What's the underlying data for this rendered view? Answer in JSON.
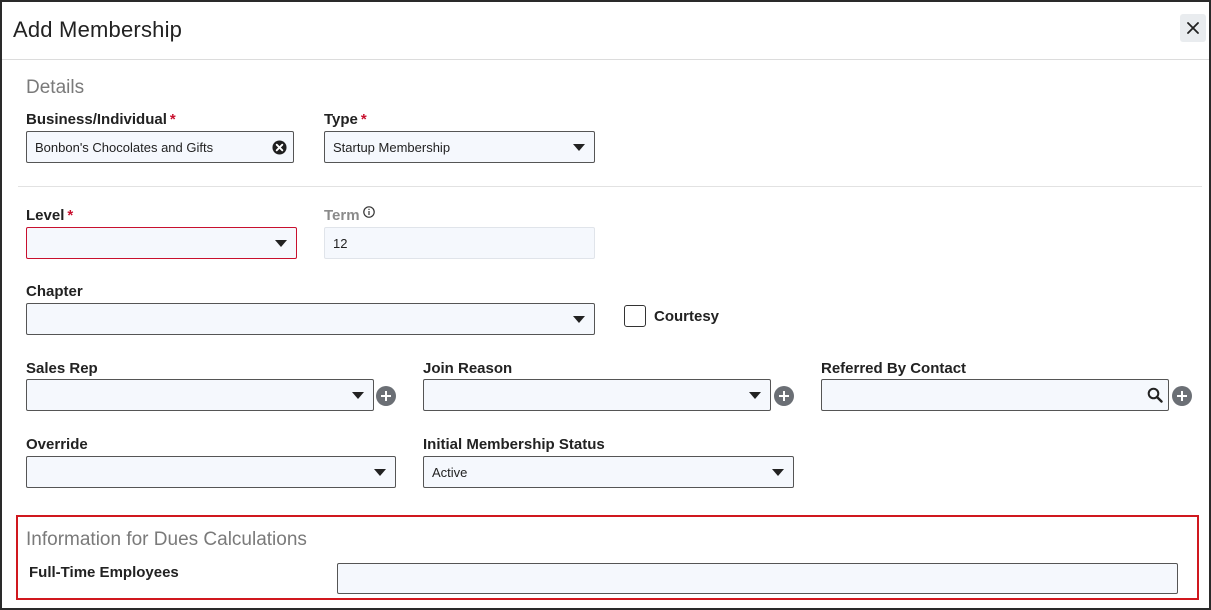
{
  "header": {
    "title": "Add Membership",
    "close_icon": "close-icon"
  },
  "details": {
    "section_title": "Details",
    "business": {
      "label": "Business/Individual",
      "required": "*",
      "value": "Bonbon's Chocolates and Gifts"
    },
    "type": {
      "label": "Type",
      "required": "*",
      "value": "Startup Membership"
    },
    "level": {
      "label": "Level",
      "required": "*",
      "value": ""
    },
    "term": {
      "label": "Term",
      "value": "12"
    },
    "chapter": {
      "label": "Chapter",
      "value": ""
    },
    "courtesy": {
      "label": "Courtesy",
      "checked": false
    },
    "sales_rep": {
      "label": "Sales Rep",
      "value": ""
    },
    "join_reason": {
      "label": "Join Reason",
      "value": ""
    },
    "referred_by": {
      "label": "Referred By Contact",
      "value": ""
    },
    "override": {
      "label": "Override",
      "value": ""
    },
    "initial_status": {
      "label": "Initial Membership Status",
      "value": "Active"
    }
  },
  "dues": {
    "section_title": "Information for Dues Calculations",
    "full_time_employees": {
      "label": "Full-Time Employees",
      "value": ""
    },
    "highlight_color": "#d0181e"
  },
  "colors": {
    "required": "#c8102e",
    "field_bg": "#f5f8fd",
    "plus_button": "#6b6f75"
  }
}
